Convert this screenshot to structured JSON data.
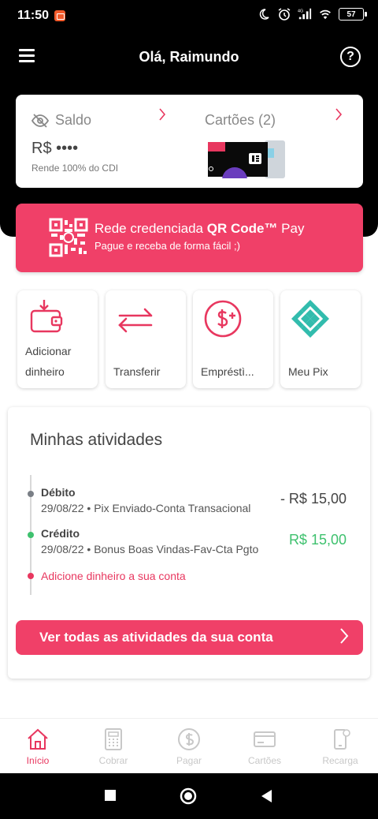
{
  "status_bar": {
    "time": "11:50",
    "battery": "57",
    "network": "4G"
  },
  "header": {
    "greeting": "Olá, Raimundo"
  },
  "balance": {
    "label": "Saldo",
    "value": "R$ ••••",
    "subtitle": "Rende 100% do CDI",
    "cards_label": "Cartões (2)"
  },
  "qr_banner": {
    "title_prefix": "Rede credenciada ",
    "title_bold": "QR Code™",
    "title_suffix": " Pay",
    "subtitle": "Pague e receba de forma fácil ;)"
  },
  "shortcuts": [
    {
      "label_line1": "Adicionar",
      "label_line2": "dinheiro",
      "icon": "wallet-add-icon"
    },
    {
      "label_line1": "Transferir",
      "label_line2": "",
      "icon": "transfer-icon"
    },
    {
      "label_line1": "Empréstì...",
      "label_line2": "",
      "icon": "loan-icon"
    },
    {
      "label_line1": "Meu Pix",
      "label_line2": "",
      "icon": "pix-icon"
    }
  ],
  "activities": {
    "title": "Minhas atividades",
    "items": [
      {
        "kind": "Débito",
        "date": "29/08/22",
        "desc": "Pix Enviado-Conta Transacional",
        "amount": "- R$ 15,00",
        "color": "#444444"
      },
      {
        "kind": "Crédito",
        "date": "29/08/22",
        "desc": "Bonus Boas Vindas-Fav-Cta Pgto",
        "amount": "R$ 15,00",
        "color": "#3ec16e"
      }
    ],
    "add_money_link": "Adicione dinheiro a sua conta",
    "see_all_button": "Ver todas as atividades da sua conta"
  },
  "bottom_nav": [
    {
      "label": "Início",
      "icon": "home-icon",
      "active": true
    },
    {
      "label": "Cobrar",
      "icon": "calculator-icon",
      "active": false
    },
    {
      "label": "Pagar",
      "icon": "dollar-icon",
      "active": false
    },
    {
      "label": "Cartões",
      "icon": "card-icon",
      "active": false
    },
    {
      "label": "Recarga",
      "icon": "phone-recharge-icon",
      "active": false
    }
  ],
  "colors": {
    "accent": "#f04068",
    "pix": "#32bcad",
    "credit": "#3ec16e",
    "header_bg": "#000000"
  }
}
